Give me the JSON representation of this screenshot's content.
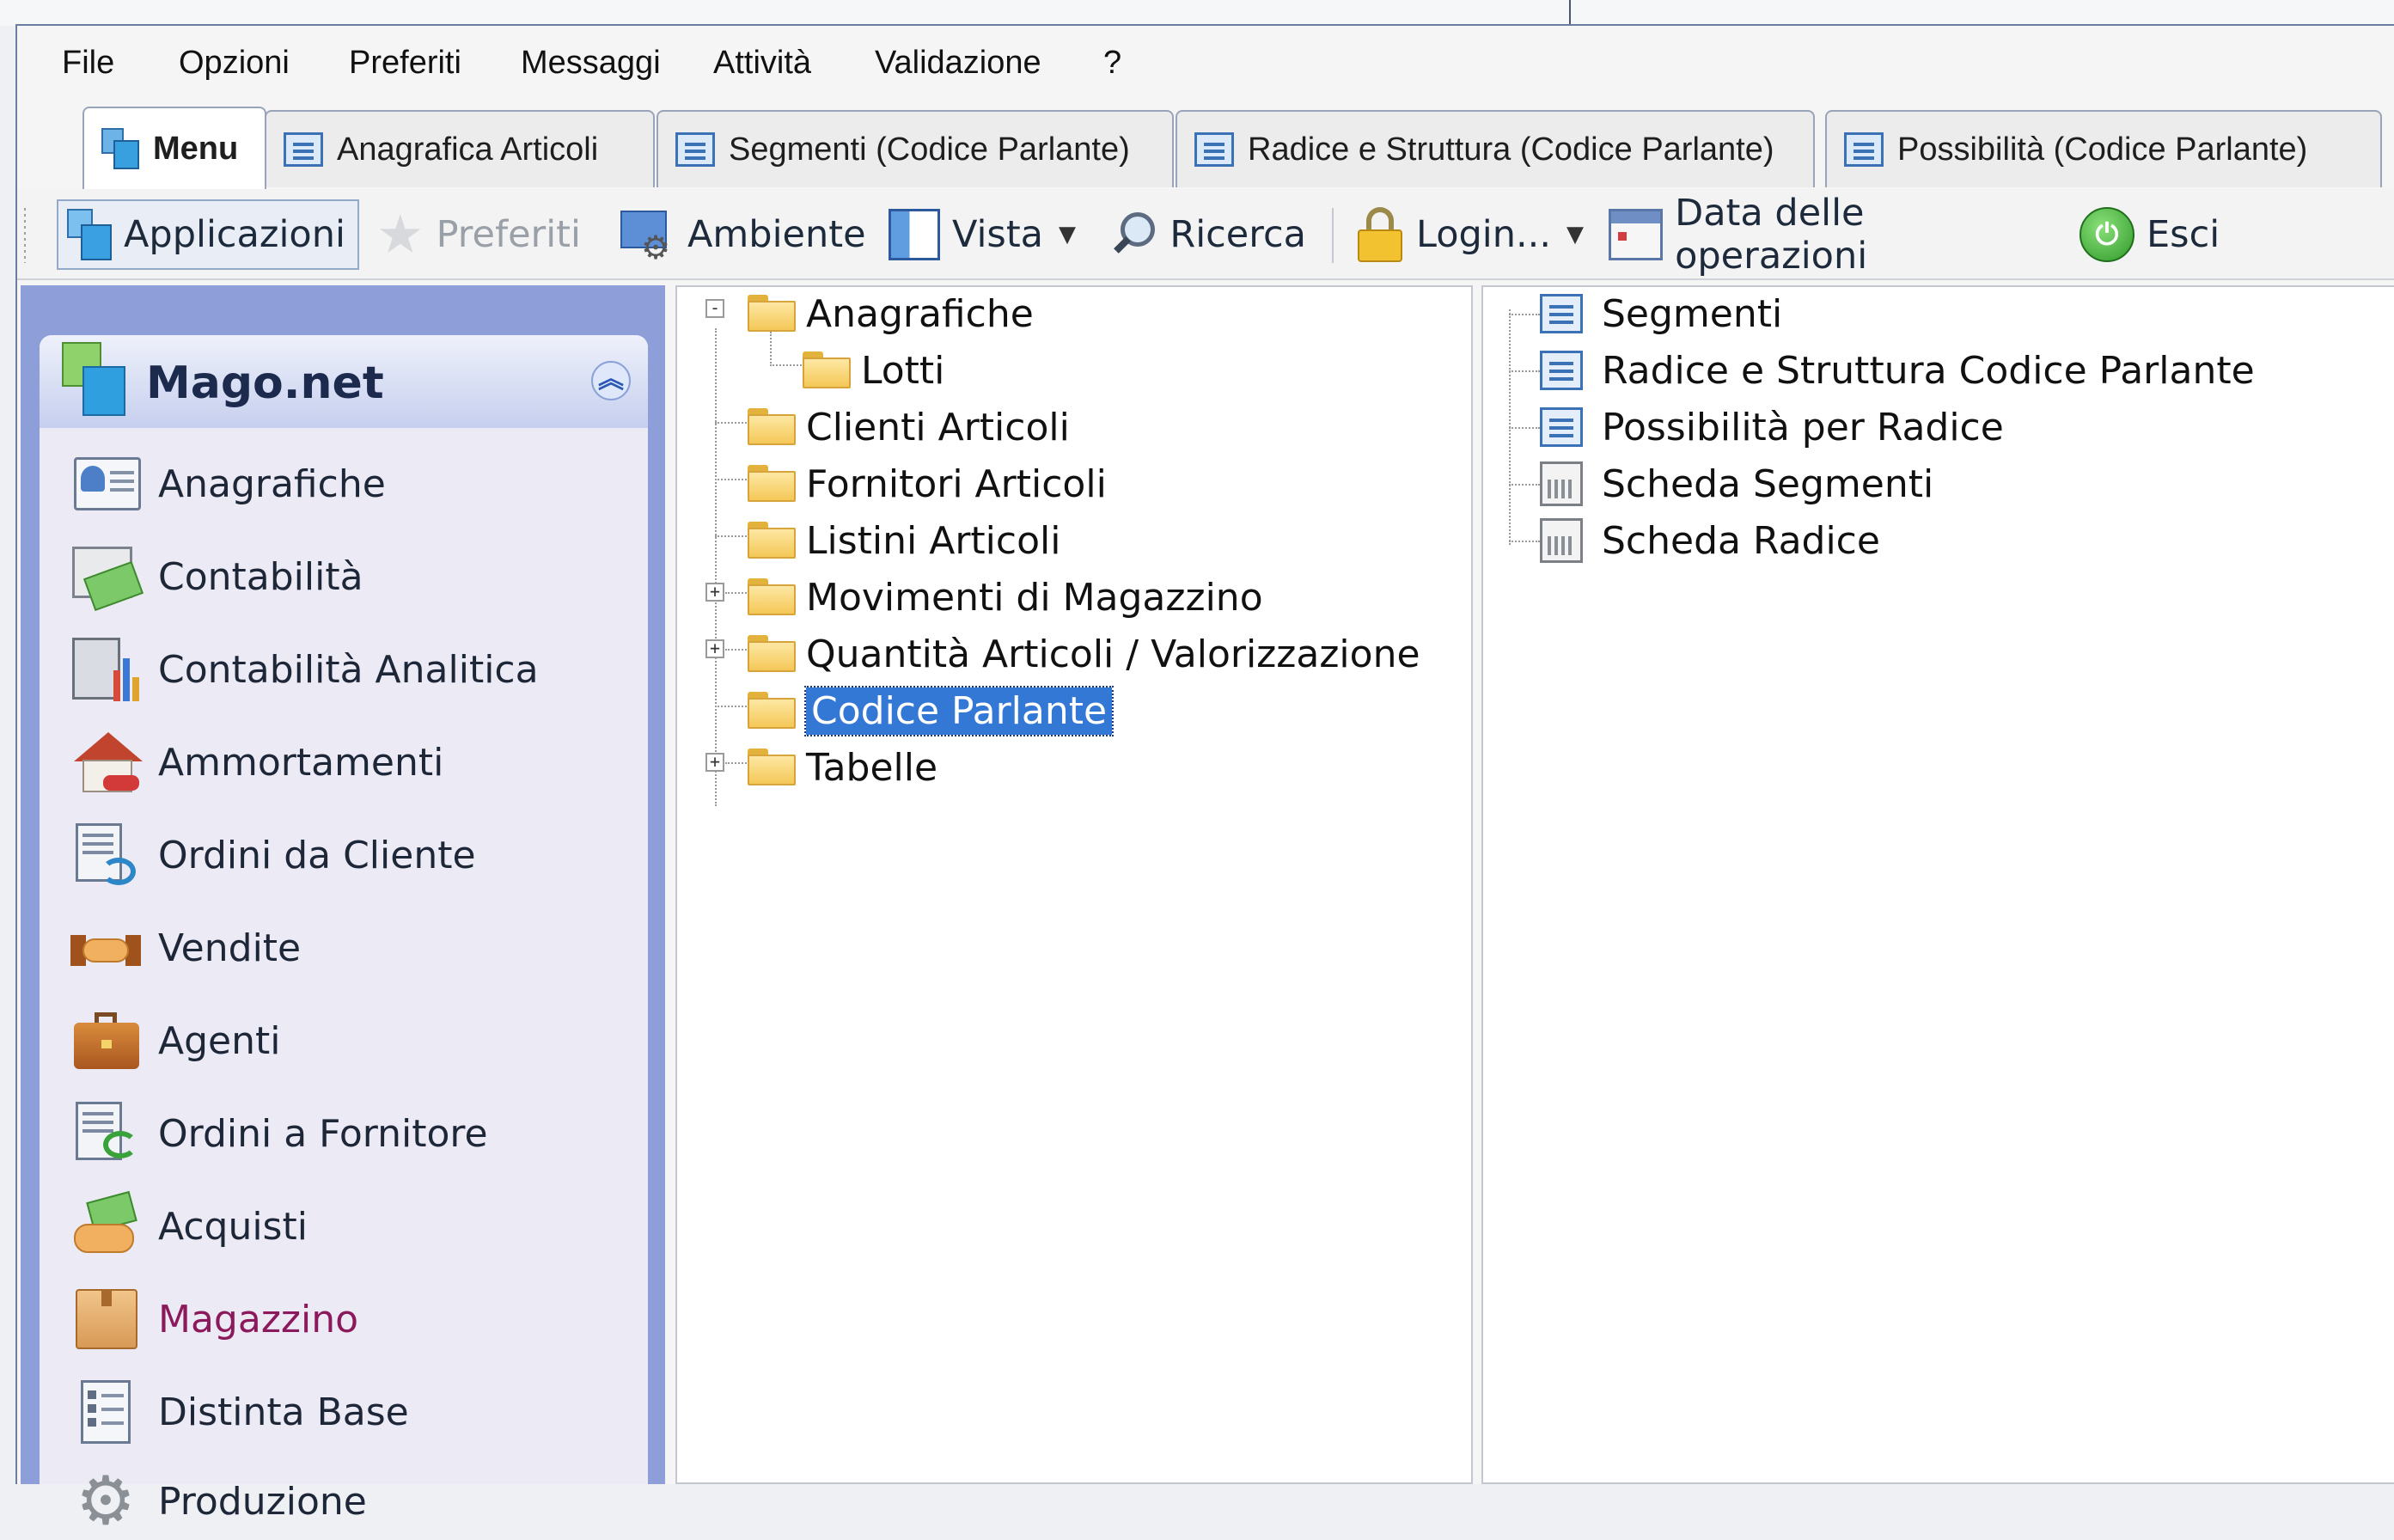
{
  "menubar": {
    "items": [
      "File",
      "Opzioni",
      "Preferiti",
      "Messaggi",
      "Attività",
      "Validazione",
      "?"
    ]
  },
  "tabs": [
    {
      "label": "Menu",
      "icon": "menu-icon",
      "active": true
    },
    {
      "label": "Anagrafica Articoli",
      "icon": "form-icon"
    },
    {
      "label": "Segmenti (Codice Parlante)",
      "icon": "form-icon"
    },
    {
      "label": "Radice e Struttura (Codice Parlante)",
      "icon": "form-icon"
    },
    {
      "label": "Possibilità (Codice Parlante)",
      "icon": "form-icon"
    }
  ],
  "toolbar": {
    "applicazioni": "Applicazioni",
    "preferiti": "Preferiti",
    "ambiente": "Ambiente",
    "vista": "Vista",
    "ricerca": "Ricerca",
    "login": "Login...",
    "data_operazioni": "Data delle operazioni",
    "esci": "Esci"
  },
  "nav": {
    "title": "Mago.net",
    "items": [
      {
        "label": "Anagrafiche",
        "icon": "contact-card-icon"
      },
      {
        "label": "Contabilità",
        "icon": "ledger-money-icon"
      },
      {
        "label": "Contabilità Analitica",
        "icon": "calculator-chart-icon"
      },
      {
        "label": "Ammortamenti",
        "icon": "house-car-icon"
      },
      {
        "label": "Ordini da Cliente",
        "icon": "customer-order-icon"
      },
      {
        "label": "Vendite",
        "icon": "handshake-icon"
      },
      {
        "label": "Agenti",
        "icon": "briefcase-icon"
      },
      {
        "label": "Ordini a Fornitore",
        "icon": "supplier-order-icon"
      },
      {
        "label": "Acquisti",
        "icon": "purchase-money-icon"
      },
      {
        "label": "Magazzino",
        "icon": "box-icon",
        "current": true
      },
      {
        "label": "Distinta Base",
        "icon": "bill-of-materials-icon"
      },
      {
        "label": "Produzione",
        "icon": "gear-icon"
      }
    ]
  },
  "tree": {
    "nodes": [
      {
        "label": "Anagrafiche",
        "expander": "-",
        "open": true
      },
      {
        "label": "Lotti"
      },
      {
        "label": "Clienti Articoli"
      },
      {
        "label": "Fornitori Articoli"
      },
      {
        "label": "Listini Articoli"
      },
      {
        "label": "Movimenti di Magazzino",
        "expander": "+"
      },
      {
        "label": "Quantità Articoli / Valorizzazione",
        "expander": "+"
      },
      {
        "label": "Codice Parlante",
        "selected": true
      },
      {
        "label": "Tabelle",
        "expander": "+"
      }
    ]
  },
  "documents": {
    "items": [
      {
        "label": "Segmenti",
        "icon": "form-icon"
      },
      {
        "label": "Radice e Struttura Codice Parlante",
        "icon": "form-icon"
      },
      {
        "label": "Possibilità per Radice",
        "icon": "form-icon"
      },
      {
        "label": "Scheda Segmenti",
        "icon": "report-icon"
      },
      {
        "label": "Scheda Radice",
        "icon": "report-icon"
      }
    ]
  },
  "colors": {
    "nav_frame": "#8e9ed8",
    "nav_background": "#ecebf5",
    "selection": "#3478d6",
    "current_nav_text": "#8b1a5c",
    "window_border": "#6b7da0"
  }
}
